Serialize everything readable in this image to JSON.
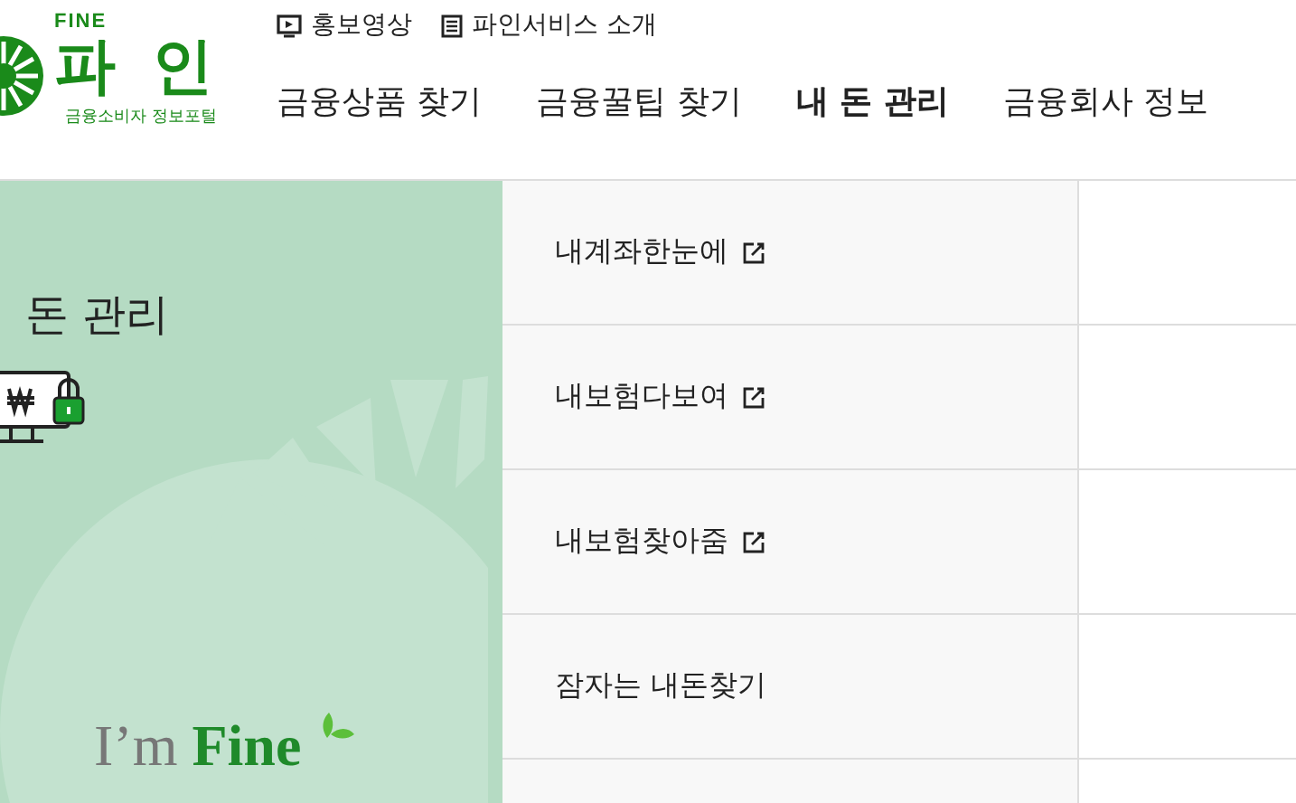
{
  "logo": {
    "eyebrow": "FINE",
    "name": "파 인",
    "tagline": "금융소비자 정보포털"
  },
  "top_links": [
    {
      "label": "홍보영상",
      "kind": "video"
    },
    {
      "label": "파인서비스 소개",
      "kind": "list"
    }
  ],
  "nav": [
    {
      "label": "금융상품 찾기",
      "selected": false
    },
    {
      "label": "금융꿀팁 찾기",
      "selected": false
    },
    {
      "label": "내 돈 관리",
      "selected": true
    },
    {
      "label": "금융회사 정보",
      "selected": false
    }
  ],
  "banner": {
    "title": "돈 관리",
    "slogan_lead": "I’m",
    "slogan_brand": "Fine"
  },
  "menu": [
    {
      "label": "내계좌한눈에",
      "external": true
    },
    {
      "label": "내보험다보여",
      "external": true
    },
    {
      "label": "내보험찾아줌",
      "external": true
    },
    {
      "label": "잠자는 내돈찾기",
      "external": false
    }
  ]
}
